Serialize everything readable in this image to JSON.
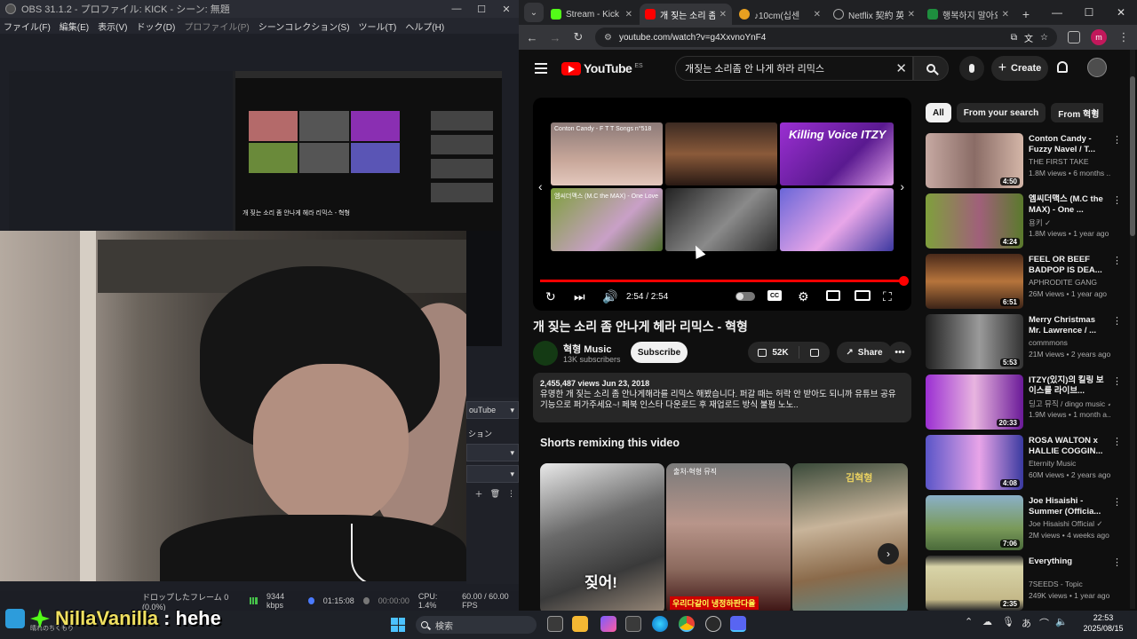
{
  "obs": {
    "title": "OBS 31.1.2 - プロファイル: KICK - シーン: 無題",
    "menu": [
      "ファイル(F)",
      "編集(E)",
      "表示(V)",
      "ドック(D)",
      "プロファイル(P)",
      "シーンコレクション(S)",
      "ツール(T)",
      "ヘルプ(H)"
    ],
    "nested_title": "개 짖는 소리 좀 안나게 헤라 리믹스 - 혁형",
    "dock": {
      "source_label": "ouTube",
      "row2": "ション"
    },
    "status": {
      "dropped": "ドロップしたフレーム 0 (0.0%)",
      "bitrate": "9344 kbps",
      "stream_time": "01:15:08",
      "rec_time": "00:00:00",
      "cpu": "CPU: 1.4%",
      "fps": "60.00 / 60.00 FPS"
    }
  },
  "chrome": {
    "tabs": [
      {
        "label": "Stream - Kick Da",
        "color": "#53fc18",
        "active": false
      },
      {
        "label": "개 짖는 소리 좀",
        "color": "#ff0000",
        "active": true
      },
      {
        "label": "♪10cm(십센",
        "color": "#e8a020",
        "active": false
      },
      {
        "label": "Netflix 契約 英語",
        "color": "#8a8a8a",
        "active": false
      },
      {
        "label": "행복하지 말아요",
        "color": "#1e8e3e",
        "active": false
      }
    ],
    "url": "youtube.com/watch?v=g4XxvnoYnF4",
    "profile_letter": "m"
  },
  "youtube": {
    "logo_text": "YouTube",
    "logo_region": "ES",
    "search_query": "개짖는 소리좀 안 나게 하라 리믹스",
    "create_label": "Create",
    "player": {
      "time": "2:54 / 2:54",
      "progress": 1.0,
      "thumb_labels": [
        "Conton Candy - F T T Songs n°518",
        "",
        "Killing Voice ITZY",
        "엠씨더맥스 (M.C the MAX) - One Love",
        "",
        ""
      ]
    },
    "video": {
      "title": "개 짖는 소리 좀 안나게 헤라 리믹스 - 혁형",
      "channel": "혁형 Music",
      "subscribers": "13K subscribers",
      "subscribe_label": "Subscribe",
      "likes": "52K",
      "share_label": "Share",
      "views_date": "2,455,487 views  Jun 23, 2018",
      "description": "유명한 개 짖는 소리 좀 안나게해라를 리믹스 해봤습니다. 퍼갈 때는 허락 안 받아도 되니까 유튜브 공유 기능으로 퍼가주세요~! 페북 인스타 다운로드 후 재업로드 방식 불펌 노노.."
    },
    "shorts": {
      "heading": "Shorts remixing this video",
      "items": [
        {
          "caption": "짖어!",
          "top": ""
        },
        {
          "caption": "우리다같이 냉정하판다율",
          "top": "출처-혁형 뮤직"
        },
        {
          "caption": "",
          "top": "김혁형"
        }
      ]
    },
    "chips": [
      "All",
      "From your search",
      "From 혁형"
    ],
    "recommendations": [
      {
        "title": "Conton Candy - Fuzzy Navel / T...",
        "channel": "THE FIRST TAKE",
        "meta": "1.8M views • 6 months ...",
        "duration": "4:50"
      },
      {
        "title": "엠씨더맥스 (M.C the MAX) - One ...",
        "channel": "용키 ✓",
        "meta": "1.8M views • 1 year ago",
        "duration": "4:24"
      },
      {
        "title": "FEEL OR BEEF BADPOP IS DEA...",
        "channel": "APHRODITE GANG",
        "meta": "26M views • 1 year ago",
        "duration": "6:51"
      },
      {
        "title": "Merry Christmas Mr. Lawrence / ...",
        "channel": "commmons",
        "meta": "21M views • 2 years ago",
        "duration": "5:53"
      },
      {
        "title": "ITZY(있지)의 킬링 보이스를 라이브...",
        "channel": "딩고 뮤직 / dingo music ✓",
        "meta": "1.9M views • 1 month a...",
        "duration": "20:33"
      },
      {
        "title": "ROSA WALTON x HALLIE COGGIN...",
        "channel": "Eternity Music",
        "meta": "60M views • 2 years ago",
        "duration": "4:08"
      },
      {
        "title": "Joe Hisaishi - Summer (Officia...",
        "channel": "Joe Hisaishi Official ✓",
        "meta": "2M views • 4 weeks ago",
        "duration": "7:06"
      },
      {
        "title": "Everything",
        "channel": "7SEEDS - Topic",
        "meta": "249K views • 1 year ago",
        "duration": "2:35"
      }
    ]
  },
  "chat": {
    "username": "NillaVanilla",
    "separator": ":",
    "message": "hehe",
    "sub": "晴れのちくもり"
  },
  "taskbar": {
    "search_placeholder": "検索",
    "time": "22:53",
    "date": "2025/08/15",
    "ime": "あ"
  },
  "colors": {
    "yt_red": "#ff0000",
    "kick_green": "#53fc18",
    "chat_name": "#f0e060"
  }
}
